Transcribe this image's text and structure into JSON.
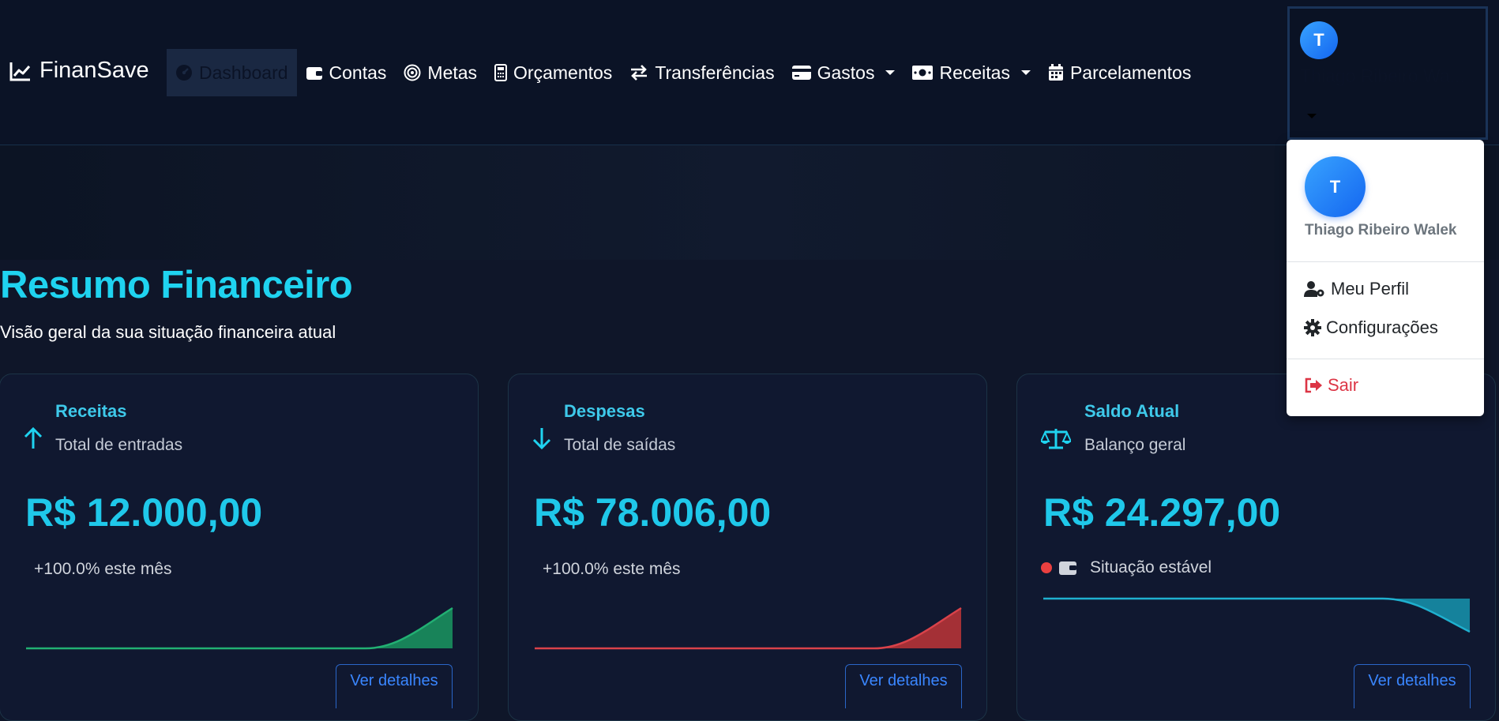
{
  "navbar": {
    "brand": "FinanSave",
    "items": [
      {
        "label": "Dashboard",
        "icon": "gauge-icon",
        "active": true
      },
      {
        "label": "Contas",
        "icon": "wallet-icon"
      },
      {
        "label": "Metas",
        "icon": "target-icon"
      },
      {
        "label": "Orçamentos",
        "icon": "calculator-icon"
      },
      {
        "label": "Transferências",
        "icon": "arrows-exchange-icon"
      },
      {
        "label": "Gastos",
        "icon": "credit-card-icon",
        "dropdown": true
      },
      {
        "label": "Receitas",
        "icon": "money-bill-icon",
        "dropdown": true
      },
      {
        "label": "Parcelamentos",
        "icon": "calendar-icon"
      }
    ],
    "user": {
      "initial": "T",
      "name": "Thiago Ribeiro Wa..."
    }
  },
  "page": {
    "title": "Resumo Financeiro",
    "subtitle": "Visão geral da sua situação financeira atual"
  },
  "cards": [
    {
      "title": "Receitas",
      "subtitle": "Total de entradas",
      "value": "R$ 12.000,00",
      "delta": "+100.0% este mês",
      "details": "Ver detalhes",
      "icon": "arrow-up-icon",
      "color": "#1fa36b"
    },
    {
      "title": "Despesas",
      "subtitle": "Total de saídas",
      "value": "R$ 78.006,00",
      "delta": "+100.0% este mês",
      "details": "Ver detalhes",
      "icon": "arrow-down-icon",
      "color": "#c73a3e"
    },
    {
      "title": "Saldo Atual",
      "subtitle": "Balanço geral",
      "value": "R$ 24.297,00",
      "status": "Situação estável",
      "details": "Ver detalhes",
      "icon": "scale-icon",
      "color": "#1aa3c4"
    }
  ],
  "dropdown": {
    "initial": "T",
    "name": "Thiago Ribeiro Walek",
    "items": [
      {
        "label": "Meu Perfil",
        "icon": "user-gear-icon"
      },
      {
        "label": "Configurações",
        "icon": "gear-icon"
      },
      {
        "label": "Sair",
        "icon": "sign-out-icon"
      }
    ]
  }
}
